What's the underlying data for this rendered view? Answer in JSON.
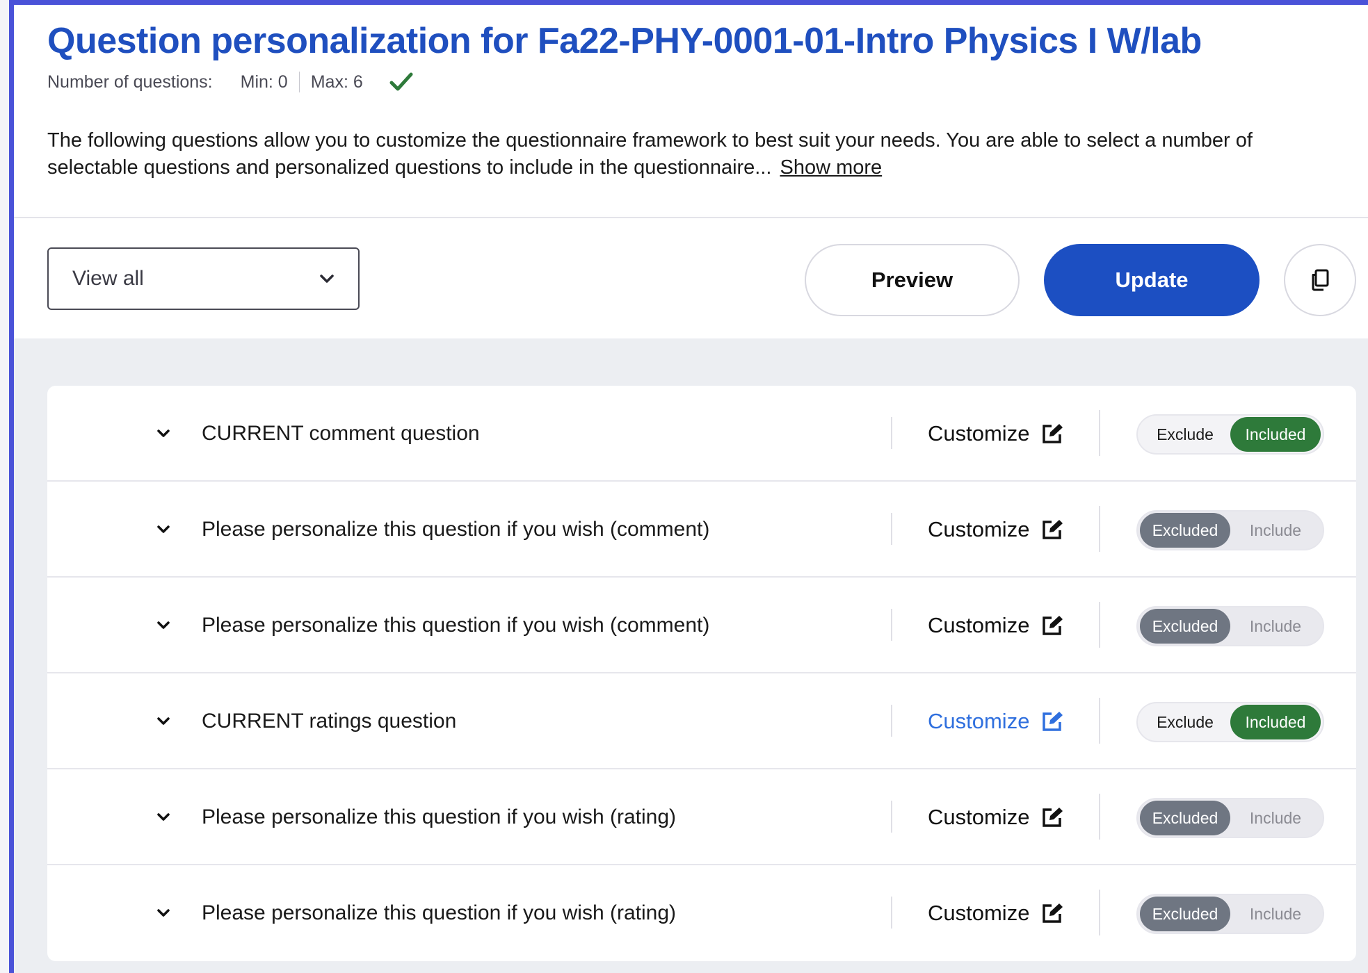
{
  "header": {
    "title": "Question personalization for Fa22-PHY-0001-01-Intro Physics I W/lab",
    "num_questions_label": "Number of questions:",
    "min": "Min: 0",
    "max": "Max: 6",
    "description": "The following questions allow you to customize the questionnaire framework to best suit your needs. You are able to select a number of selectable questions and personalized questions to include in the questionnaire...",
    "show_more": "Show more"
  },
  "toolbar": {
    "filter_value": "View all",
    "preview_label": "Preview",
    "update_label": "Update"
  },
  "questions": [
    {
      "text": "CURRENT comment question",
      "customize": "Customize",
      "left": "Exclude",
      "right": "Included",
      "state": "included"
    },
    {
      "text": "Please personalize this question if you wish (comment)",
      "customize": "Customize",
      "left": "Excluded",
      "right": "Include",
      "state": "excluded"
    },
    {
      "text": "Please personalize this question if you wish (comment)",
      "customize": "Customize",
      "left": "Excluded",
      "right": "Include",
      "state": "excluded"
    },
    {
      "text": "CURRENT ratings question",
      "customize": "Customize",
      "left": "Exclude",
      "right": "Included",
      "state": "included"
    },
    {
      "text": "Please personalize this question if you wish (rating)",
      "customize": "Customize",
      "left": "Excluded",
      "right": "Include",
      "state": "excluded"
    },
    {
      "text": "Please personalize this question if you wish (rating)",
      "customize": "Customize",
      "left": "Excluded",
      "right": "Include",
      "state": "excluded"
    }
  ],
  "colors": {
    "accent_blue": "#1c4fc2",
    "included_green": "#2e7a3a",
    "excluded_grey": "#6f7682",
    "frame_border": "#4a52d8"
  },
  "icons": {
    "valid": "check-icon",
    "dropdown": "chevron-down-icon",
    "copy": "copy-icon",
    "edit": "edit-icon"
  }
}
